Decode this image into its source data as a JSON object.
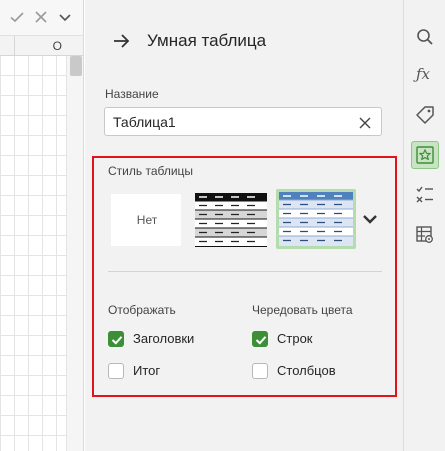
{
  "sheet": {
    "column_letter": "O"
  },
  "panel": {
    "title": "Умная таблица",
    "name_field": {
      "label": "Название",
      "value": "Таблица1"
    },
    "table_style": {
      "label": "Стиль таблицы",
      "none_label": "Нет",
      "selected_index": 2
    },
    "display": {
      "heading": "Отображать",
      "options": [
        {
          "label": "Заголовки",
          "checked": true
        },
        {
          "label": "Итог",
          "checked": false
        }
      ]
    },
    "alternate": {
      "heading": "Чередовать цвета",
      "options": [
        {
          "label": "Строк",
          "checked": true
        },
        {
          "label": "Столбцов",
          "checked": false
        }
      ]
    }
  },
  "rail": {
    "items": [
      "search-icon",
      "function-icon",
      "tag-icon",
      "star-icon",
      "checklist-icon",
      "table-settings-icon"
    ],
    "active_item": "star-icon"
  },
  "colors": {
    "accent_green": "#3c8f36",
    "highlight_red": "#e0141b",
    "panel_bg": "#f2f2f2"
  }
}
